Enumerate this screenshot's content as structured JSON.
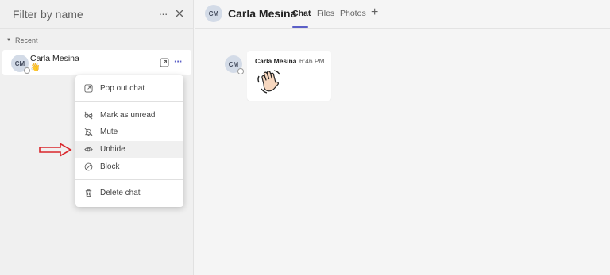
{
  "left_pane": {
    "filter_placeholder": "Filter by name",
    "more_label": "···",
    "section_label": "Recent",
    "chat_item": {
      "initials": "CM",
      "name": "Carla Mesina",
      "preview_emoji": "👋",
      "more_label": "···"
    }
  },
  "context_menu": {
    "items": [
      {
        "label": "Pop out chat",
        "icon": "popout-icon"
      },
      {
        "label": "Mark as unread",
        "icon": "glasses-icon"
      },
      {
        "label": "Mute",
        "icon": "bell-off-icon"
      },
      {
        "label": "Unhide",
        "icon": "eye-icon",
        "highlighted": true
      },
      {
        "label": "Block",
        "icon": "block-icon"
      },
      {
        "label": "Delete chat",
        "icon": "trash-icon"
      }
    ]
  },
  "header": {
    "initials": "CM",
    "name": "Carla Mesina",
    "tabs": [
      {
        "label": "Chat",
        "active": true
      },
      {
        "label": "Files",
        "active": false
      },
      {
        "label": "Photos",
        "active": false
      }
    ],
    "add_tab_label": "+"
  },
  "message": {
    "initials": "CM",
    "author": "Carla Mesina",
    "time": "6:46 PM",
    "content": "waving-hand"
  },
  "colors": {
    "accent": "#5b5fc7",
    "arrow": "#d9262b"
  }
}
